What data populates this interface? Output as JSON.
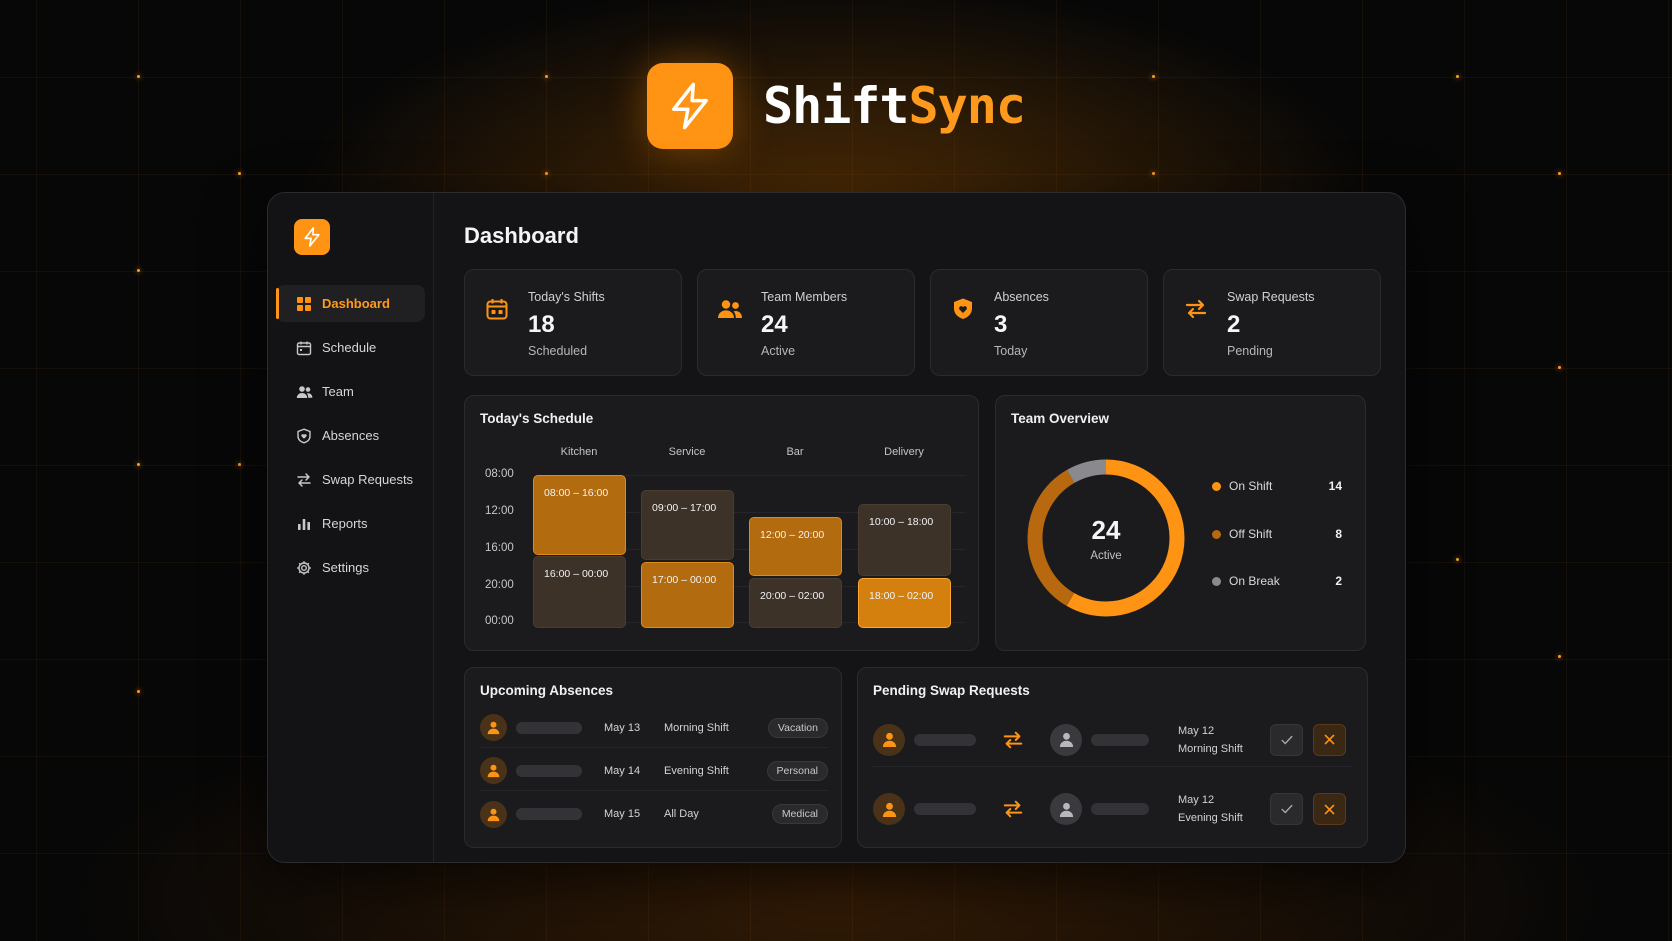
{
  "brand": {
    "name_part1": "Shift",
    "name_part2": "Sync",
    "logo_icon": "lightning-bolt-icon"
  },
  "colors": {
    "accent": "#ff9314",
    "accent_dark": "#b36b10",
    "background": "#070707",
    "panel": "#1b1b1e"
  },
  "sidebar": {
    "items": [
      {
        "label": "Dashboard",
        "icon": "grid-icon",
        "active": true
      },
      {
        "label": "Schedule",
        "icon": "calendar-icon"
      },
      {
        "label": "Team",
        "icon": "users-icon"
      },
      {
        "label": "Absences",
        "icon": "shield-icon"
      },
      {
        "label": "Swap Requests",
        "icon": "swap-arrows-icon"
      },
      {
        "label": "Reports",
        "icon": "bar-chart-icon"
      },
      {
        "label": "Settings",
        "icon": "gear-icon"
      }
    ]
  },
  "page": {
    "title": "Dashboard"
  },
  "stats": [
    {
      "label": "Today's Shifts",
      "value": "18",
      "sub": "Scheduled",
      "icon": "calendar-icon"
    },
    {
      "label": "Team Members",
      "value": "24",
      "sub": "Active",
      "icon": "users-icon"
    },
    {
      "label": "Absences",
      "value": "3",
      "sub": "Today",
      "icon": "shield-heart-icon"
    },
    {
      "label": "Swap Requests",
      "value": "2",
      "sub": "Pending",
      "icon": "swap-arrows-icon"
    }
  ],
  "schedule": {
    "title": "Today's Schedule",
    "columns": [
      "Kitchen",
      "Service",
      "Bar",
      "Delivery"
    ],
    "times": [
      "08:00",
      "12:00",
      "16:00",
      "20:00",
      "00:00"
    ],
    "shifts": [
      {
        "label": "08:00 – 16:00",
        "column": 0,
        "style": "hot"
      },
      {
        "label": "16:00 – 00:00",
        "column": 0,
        "style": "dim"
      },
      {
        "label": "09:00 – 17:00",
        "column": 1,
        "style": "dim"
      },
      {
        "label": "17:00 – 00:00",
        "column": 1,
        "style": "hot"
      },
      {
        "label": "12:00 – 20:00",
        "column": 2,
        "style": "hot"
      },
      {
        "label": "20:00 – 02:00",
        "column": 2,
        "style": "dim"
      },
      {
        "label": "10:00 – 18:00",
        "column": 3,
        "style": "dim"
      },
      {
        "label": "18:00 – 02:00",
        "column": 3,
        "style": "lite"
      }
    ]
  },
  "team_overview": {
    "title": "Team Overview",
    "center_value": "24",
    "center_label": "Active",
    "segments": [
      {
        "label": "On Shift",
        "count": "14",
        "color": "#ff9314"
      },
      {
        "label": "Off Shift",
        "count": "8",
        "color": "#b8680f"
      },
      {
        "label": "On Break",
        "count": "2",
        "color": "#8a8a8e"
      }
    ]
  },
  "absences": {
    "title": "Upcoming Absences",
    "rows": [
      {
        "date": "May 13",
        "shift": "Morning Shift",
        "type": "Vacation"
      },
      {
        "date": "May 14",
        "shift": "Evening Shift",
        "type": "Personal"
      },
      {
        "date": "May 15",
        "shift": "All Day",
        "type": "Medical"
      }
    ]
  },
  "swaps": {
    "title": "Pending Swap Requests",
    "rows": [
      {
        "date": "May 12",
        "shift": "Morning Shift"
      },
      {
        "date": "May 12",
        "shift": "Evening Shift"
      }
    ]
  }
}
